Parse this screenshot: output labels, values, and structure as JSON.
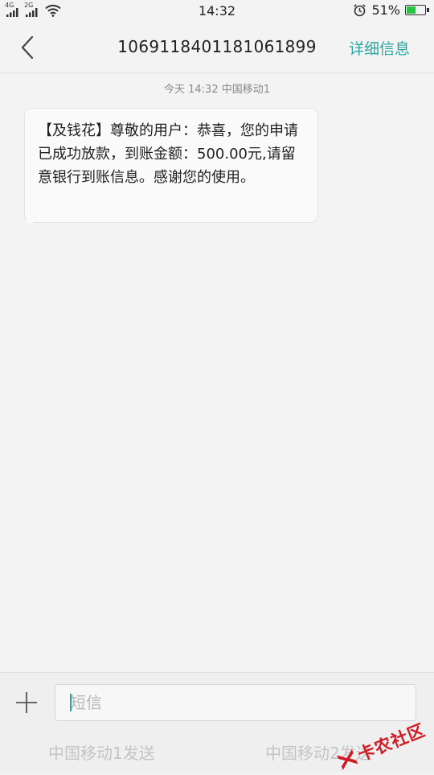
{
  "status_bar": {
    "network1": "4G",
    "network2": "2G",
    "time": "14:32",
    "battery_percent": "51%",
    "battery_level": 0.51,
    "colors": {
      "battery_fill": "#2cc24a"
    }
  },
  "nav": {
    "title": "1069118401181061899",
    "details_label": "详细信息",
    "back_icon": "chevron-left-icon"
  },
  "conversation": {
    "meta": "今天  14:32  中国移动1",
    "message": "【及钱花】尊敬的用户：恭喜，您的申请已成功放款，到账金额：500.00元,请留意银行到账信息。感谢您的使用。"
  },
  "composer": {
    "placeholder": "短信",
    "value": "",
    "attach_icon": "plus-icon",
    "send_sim1": "中国移动1发送",
    "send_sim2": "中国移动2发送"
  },
  "watermark": {
    "text": "卡农社区"
  },
  "colors": {
    "accent": "#2aa7a2",
    "background": "#f3f3f3",
    "watermark": "#d01b24"
  }
}
